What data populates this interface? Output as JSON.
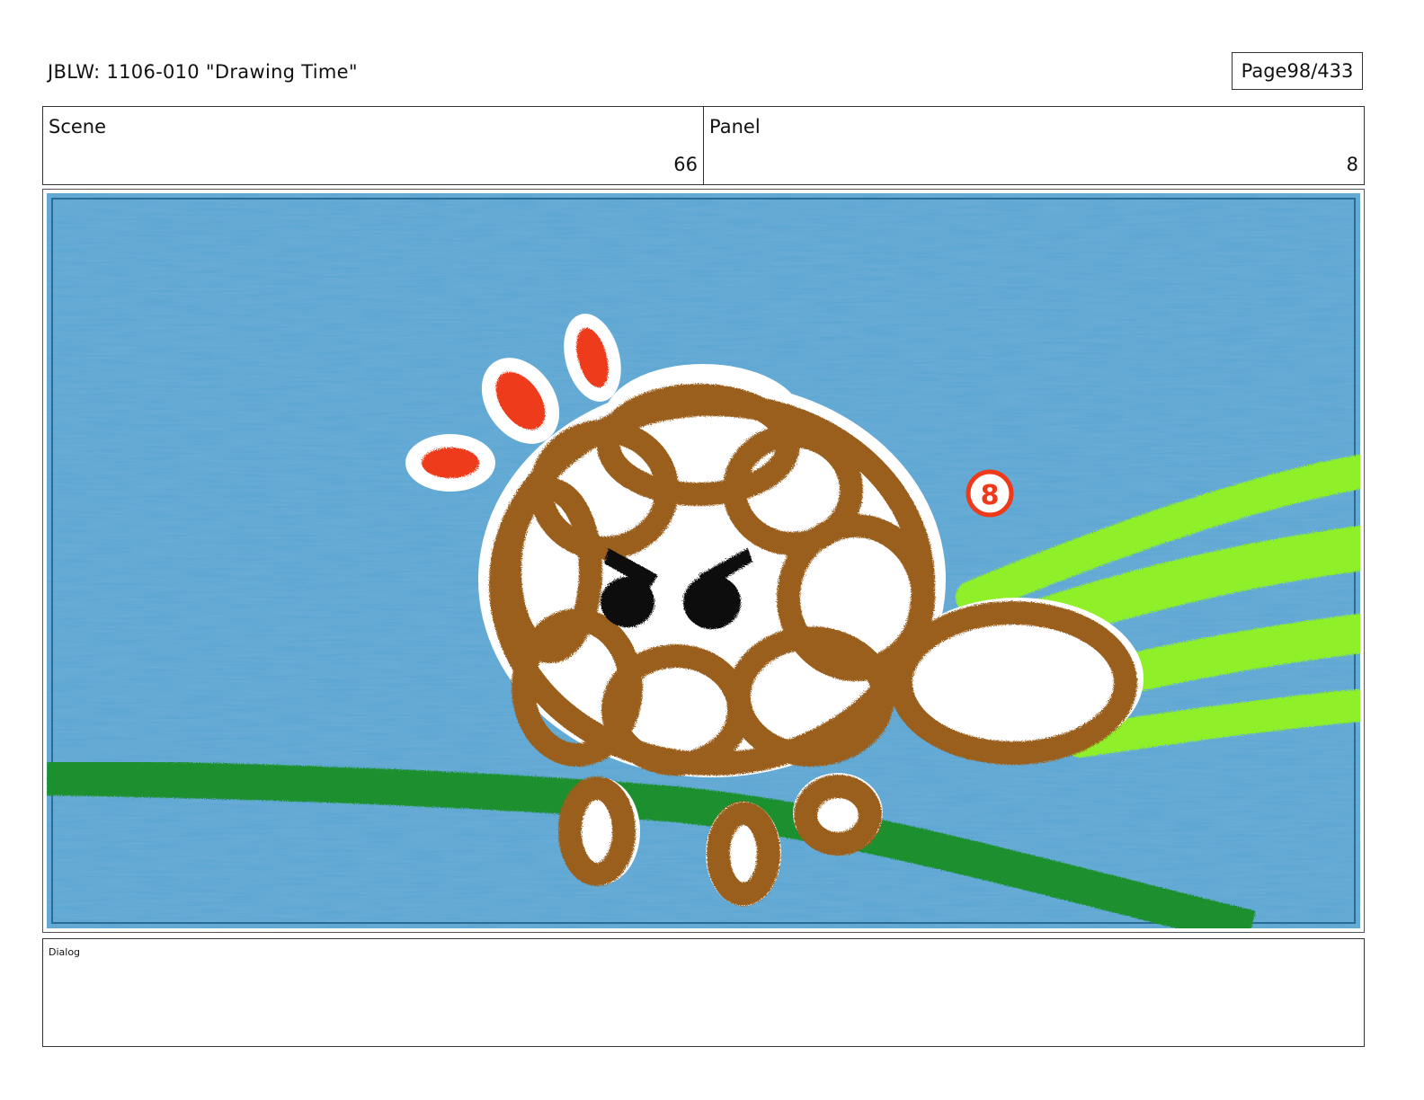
{
  "header": {
    "title": "JBLW: 1106-010 \"Drawing Time\"",
    "page_label": "Page",
    "page_number": "98/433"
  },
  "scene": {
    "label": "Scene",
    "value": "66"
  },
  "panel": {
    "label": "Panel",
    "value": "8"
  },
  "artwork": {
    "marker_number": "8"
  },
  "dialog": {
    "label": "Dialog",
    "text": ""
  },
  "colors": {
    "sky": "#5ba6d3",
    "grass": "#1f8f2e",
    "speed_lines": "#8ff02a",
    "creature": "#9a5f1c",
    "alert_marks": "#ee3a1a"
  }
}
